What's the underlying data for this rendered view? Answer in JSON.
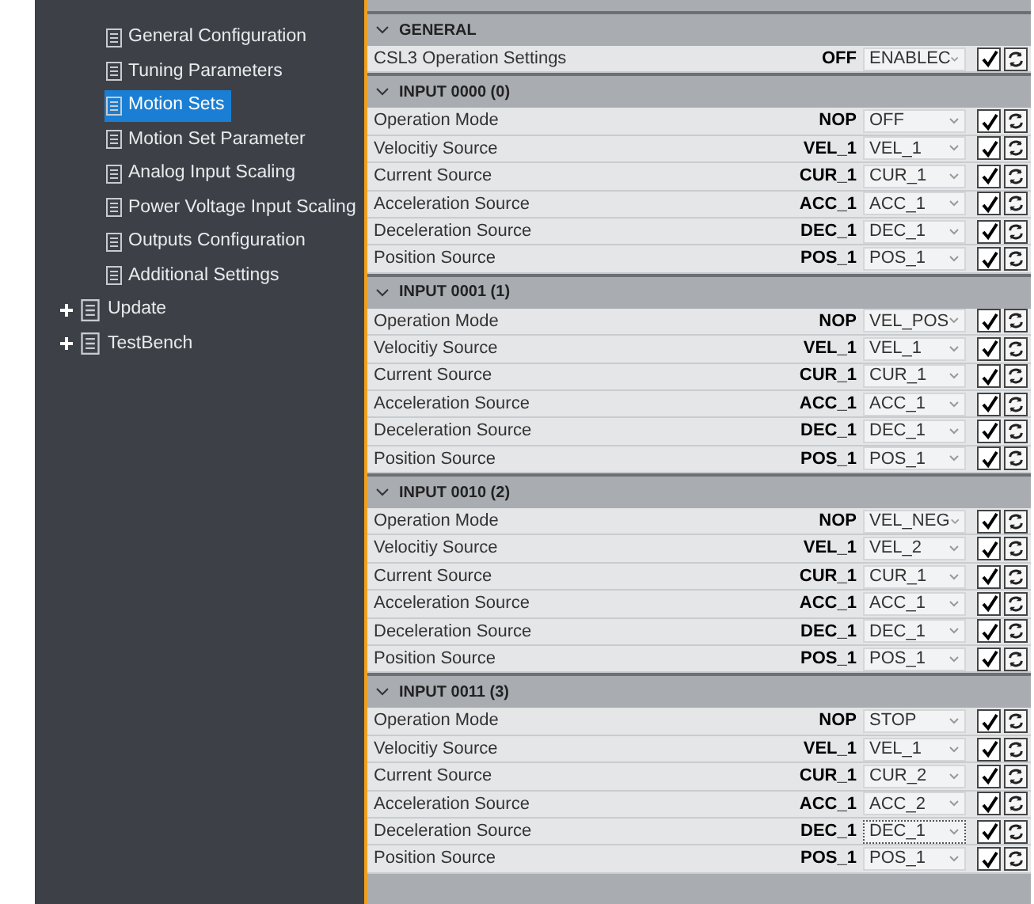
{
  "sidebar": {
    "items": [
      {
        "label": "General Configuration",
        "selected": false
      },
      {
        "label": "Tuning Parameters",
        "selected": false
      },
      {
        "label": "Motion Sets",
        "selected": true
      },
      {
        "label": "Motion Set Parameter",
        "selected": false
      },
      {
        "label": "Analog Input Scaling",
        "selected": false
      },
      {
        "label": "Power Voltage Input Scaling",
        "selected": false
      },
      {
        "label": "Outputs Configuration",
        "selected": false
      },
      {
        "label": "Additional Settings",
        "selected": false
      }
    ],
    "groups": [
      {
        "label": "Update",
        "expanded": false
      },
      {
        "label": "TestBench",
        "expanded": false
      }
    ]
  },
  "sections": [
    {
      "title": "GENERAL",
      "expanded": true,
      "rows": [
        {
          "label": "CSL3 Operation Settings",
          "current": "OFF",
          "value": "ENABLEC",
          "focused": false,
          "checked": true
        }
      ]
    },
    {
      "title": "INPUT 0000 (0)",
      "expanded": true,
      "rows": [
        {
          "label": "Operation Mode",
          "current": "NOP",
          "value": "OFF",
          "focused": false,
          "checked": true
        },
        {
          "label": "Velocitiy Source",
          "current": "VEL_1",
          "value": "VEL_1",
          "focused": false,
          "checked": true
        },
        {
          "label": "Current Source",
          "current": "CUR_1",
          "value": "CUR_1",
          "focused": false,
          "checked": true
        },
        {
          "label": "Acceleration Source",
          "current": "ACC_1",
          "value": "ACC_1",
          "focused": false,
          "checked": true
        },
        {
          "label": "Deceleration Source",
          "current": "DEC_1",
          "value": "DEC_1",
          "focused": false,
          "checked": true
        },
        {
          "label": "Position Source",
          "current": "POS_1",
          "value": "POS_1",
          "focused": false,
          "checked": true
        }
      ]
    },
    {
      "title": "INPUT 0001 (1)",
      "expanded": true,
      "rows": [
        {
          "label": "Operation Mode",
          "current": "NOP",
          "value": "VEL_POS",
          "focused": false,
          "checked": true
        },
        {
          "label": "Velocitiy Source",
          "current": "VEL_1",
          "value": "VEL_1",
          "focused": false,
          "checked": true
        },
        {
          "label": "Current Source",
          "current": "CUR_1",
          "value": "CUR_1",
          "focused": false,
          "checked": true
        },
        {
          "label": "Acceleration Source",
          "current": "ACC_1",
          "value": "ACC_1",
          "focused": false,
          "checked": true
        },
        {
          "label": "Deceleration Source",
          "current": "DEC_1",
          "value": "DEC_1",
          "focused": false,
          "checked": true
        },
        {
          "label": "Position Source",
          "current": "POS_1",
          "value": "POS_1",
          "focused": false,
          "checked": true
        }
      ]
    },
    {
      "title": "INPUT 0010 (2)",
      "expanded": true,
      "rows": [
        {
          "label": "Operation Mode",
          "current": "NOP",
          "value": "VEL_NEG",
          "focused": false,
          "checked": true
        },
        {
          "label": "Velocitiy Source",
          "current": "VEL_1",
          "value": "VEL_2",
          "focused": false,
          "checked": true
        },
        {
          "label": "Current Source",
          "current": "CUR_1",
          "value": "CUR_1",
          "focused": false,
          "checked": true
        },
        {
          "label": "Acceleration Source",
          "current": "ACC_1",
          "value": "ACC_1",
          "focused": false,
          "checked": true
        },
        {
          "label": "Deceleration Source",
          "current": "DEC_1",
          "value": "DEC_1",
          "focused": false,
          "checked": true
        },
        {
          "label": "Position Source",
          "current": "POS_1",
          "value": "POS_1",
          "focused": false,
          "checked": true
        }
      ]
    },
    {
      "title": "INPUT 0011 (3)",
      "expanded": true,
      "rows": [
        {
          "label": "Operation Mode",
          "current": "NOP",
          "value": "STOP",
          "focused": false,
          "checked": true
        },
        {
          "label": "Velocitiy Source",
          "current": "VEL_1",
          "value": "VEL_1",
          "focused": false,
          "checked": true
        },
        {
          "label": "Current Source",
          "current": "CUR_1",
          "value": "CUR_2",
          "focused": false,
          "checked": true
        },
        {
          "label": "Acceleration Source",
          "current": "ACC_1",
          "value": "ACC_2",
          "focused": false,
          "checked": true
        },
        {
          "label": "Deceleration Source",
          "current": "DEC_1",
          "value": "DEC_1",
          "focused": true,
          "checked": true
        },
        {
          "label": "Position Source",
          "current": "POS_1",
          "value": "POS_1",
          "focused": false,
          "checked": true
        }
      ]
    }
  ]
}
